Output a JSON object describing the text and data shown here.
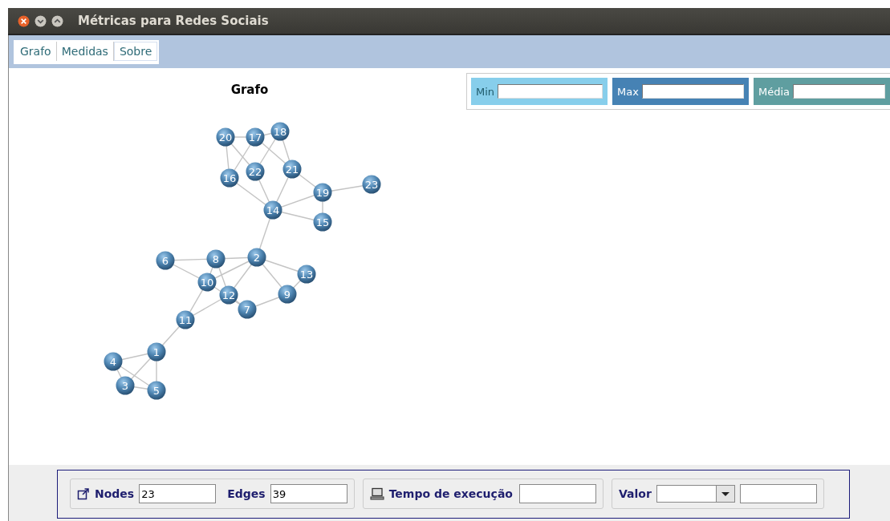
{
  "window": {
    "title": "Métricas para Redes Sociais"
  },
  "toolbar_buttons": [
    "Grafo",
    "Medidas",
    "Sobre"
  ],
  "graph": {
    "title": "Grafo",
    "nodes": [
      {
        "label": "1"
      },
      {
        "label": "2"
      },
      {
        "label": "3"
      },
      {
        "label": "4"
      },
      {
        "label": "5"
      },
      {
        "label": "6"
      },
      {
        "label": "7"
      },
      {
        "label": "8"
      },
      {
        "label": "9"
      },
      {
        "label": "10"
      },
      {
        "label": "11"
      },
      {
        "label": "12"
      },
      {
        "label": "13"
      },
      {
        "label": "14"
      },
      {
        "label": "15"
      },
      {
        "label": "16"
      },
      {
        "label": "17"
      },
      {
        "label": "18"
      },
      {
        "label": "19"
      },
      {
        "label": "20"
      },
      {
        "label": "21"
      },
      {
        "label": "22"
      },
      {
        "label": "23"
      }
    ]
  },
  "metrics": [
    {
      "label": "Min",
      "color": "#87ceeb"
    },
    {
      "label": "Max",
      "color": "#4682b4"
    },
    {
      "label": "Média",
      "color": "#5f9ea0"
    }
  ],
  "status": {
    "nodes_label": "Nodes",
    "nodes_value": "23",
    "edges_label": "Edges",
    "edges_value": "39",
    "time_label": "Tempo de execução",
    "valor_label": "Valor"
  }
}
